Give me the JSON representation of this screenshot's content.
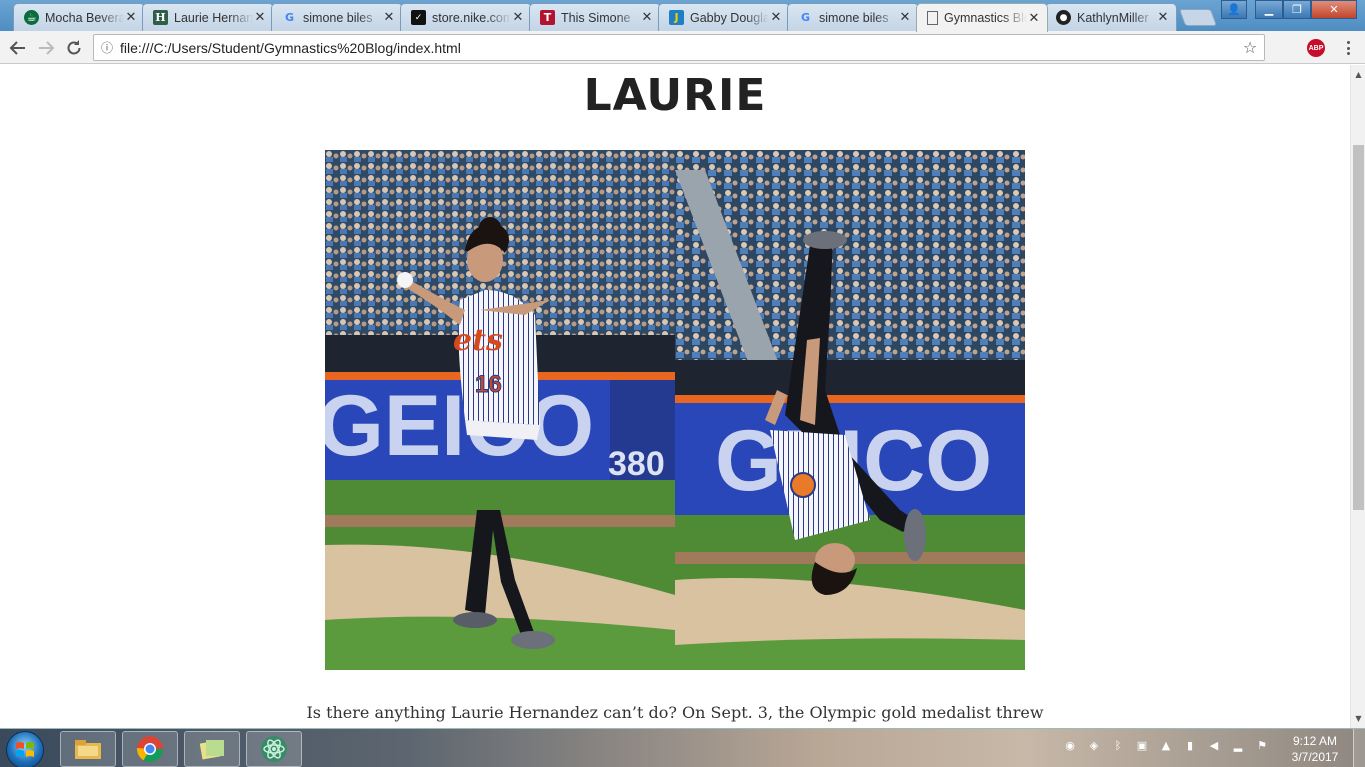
{
  "browser": {
    "tabs": [
      {
        "title": "Mocha Beverages",
        "icon": "starbucks-icon",
        "active": false
      },
      {
        "title": "Laurie Hernandez",
        "icon": "h-site-icon",
        "active": false
      },
      {
        "title": "simone biles",
        "icon": "google-icon",
        "active": false
      },
      {
        "title": "store.nike.com",
        "icon": "nike-icon",
        "active": false
      },
      {
        "title": "This Simone",
        "icon": "t-site-icon",
        "active": false
      },
      {
        "title": "Gabby Douglas",
        "icon": "j-site-icon",
        "active": false
      },
      {
        "title": "simone biles",
        "icon": "google-icon",
        "active": false
      },
      {
        "title": "Gymnastics Blog",
        "icon": "page-icon",
        "active": true
      },
      {
        "title": "KathlynMiller",
        "icon": "github-icon",
        "active": false
      }
    ],
    "address": "file:///C:/Users/Student/Gymnastics%20Blog/index.html",
    "extension_label": "ABP"
  },
  "page": {
    "heading": "LAURIE",
    "photo": {
      "left_scoreboard": "GEICO",
      "left_number": "380",
      "right_scoreboard": "GEICO",
      "jersey_text": "ets",
      "jersey_number": "16"
    },
    "caption": "Is there anything Laurie Hernandez can’t do? On Sept. 3, the Olympic gold medalist threw"
  },
  "taskbar": {
    "time": "9:12 AM",
    "date": "3/7/2017",
    "pinned": [
      "file-explorer-icon",
      "chrome-icon",
      "sticky-notes-icon",
      "atom-icon"
    ]
  }
}
